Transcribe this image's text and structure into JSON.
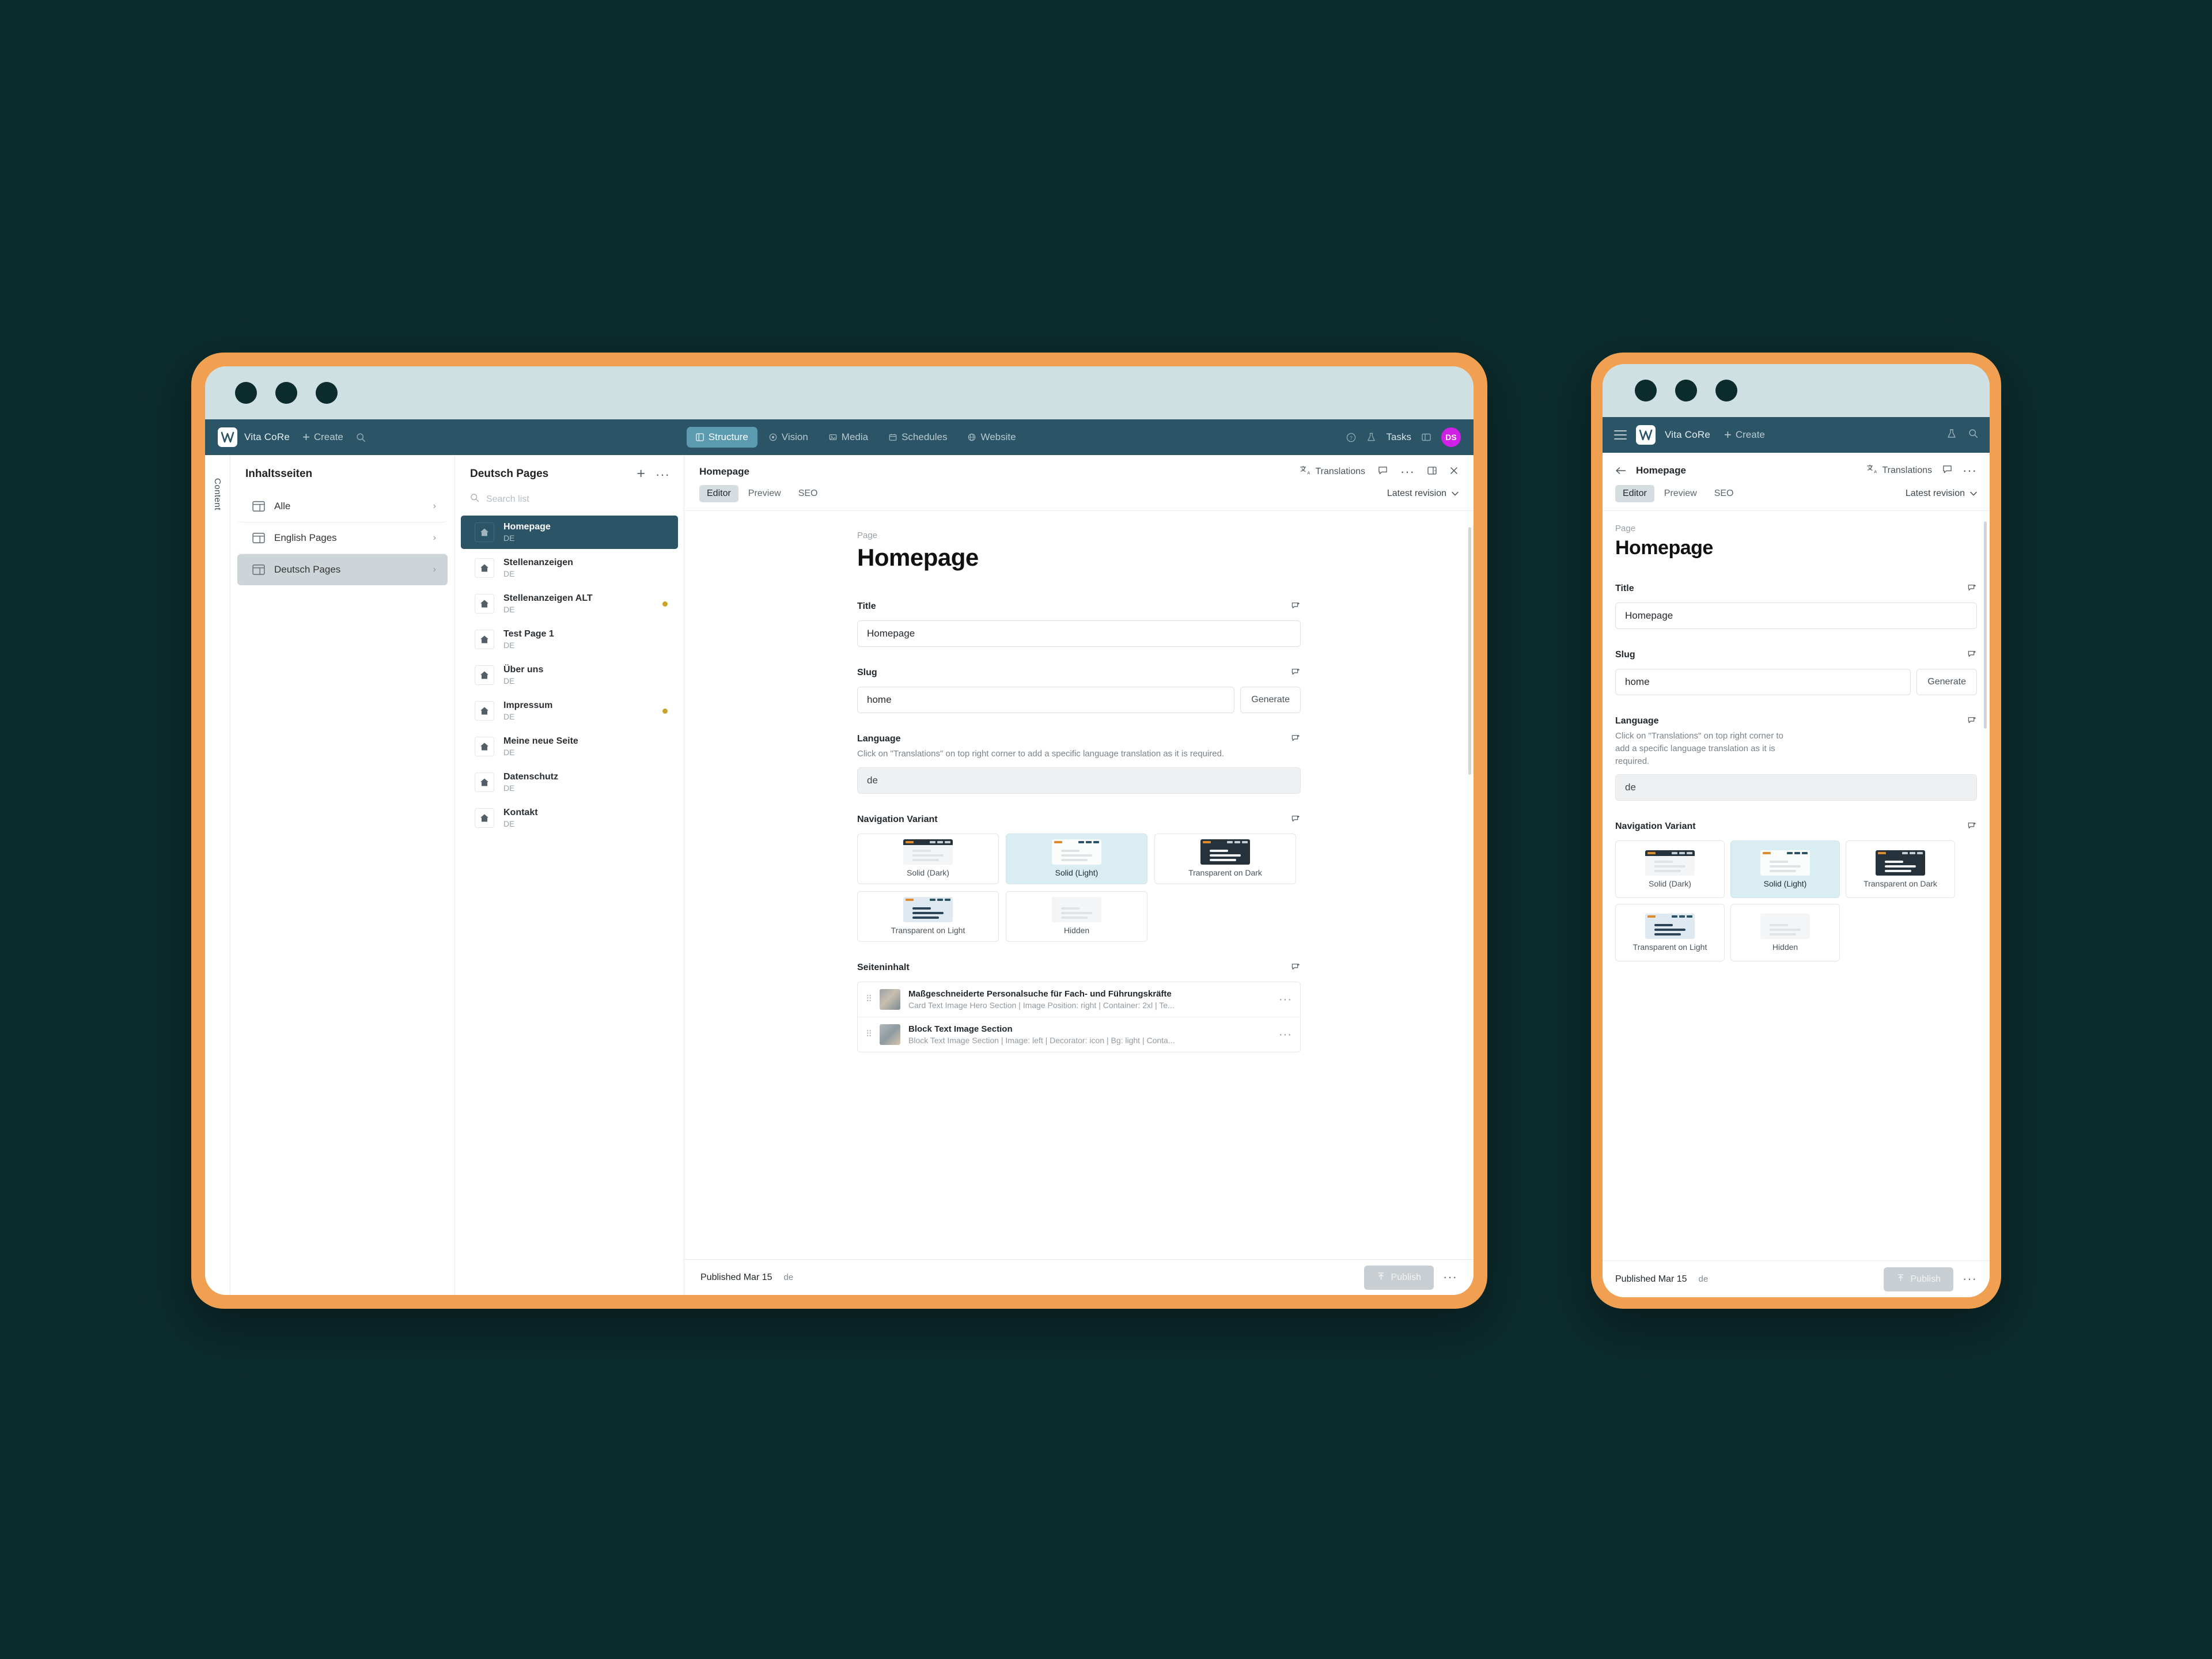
{
  "app": {
    "brand": "Vita CoRe",
    "create_label": "Create",
    "tasks_label": "Tasks",
    "avatar_initials": "DS",
    "nav_tabs": [
      {
        "label": "Structure",
        "icon": "structure-icon",
        "active": true
      },
      {
        "label": "Vision",
        "icon": "vision-icon",
        "active": false
      },
      {
        "label": "Media",
        "icon": "media-icon",
        "active": false
      },
      {
        "label": "Schedules",
        "icon": "calendar-icon",
        "active": false
      },
      {
        "label": "Website",
        "icon": "globe-icon",
        "active": false
      }
    ]
  },
  "rail": {
    "label": "Content"
  },
  "structure_panel": {
    "title": "Inhaltsseiten",
    "items": [
      {
        "label": "Alle",
        "selected": false
      },
      {
        "label": "English Pages",
        "selected": false
      },
      {
        "label": "Deutsch Pages",
        "selected": true
      }
    ]
  },
  "list_panel": {
    "title": "Deutsch Pages",
    "search_placeholder": "Search list",
    "pages": [
      {
        "name": "Homepage",
        "lang": "DE",
        "active": true,
        "dot": false
      },
      {
        "name": "Stellenanzeigen",
        "lang": "DE",
        "active": false,
        "dot": false
      },
      {
        "name": "Stellenanzeigen ALT",
        "lang": "DE",
        "active": false,
        "dot": true
      },
      {
        "name": "Test Page 1",
        "lang": "DE",
        "active": false,
        "dot": false
      },
      {
        "name": "Über uns",
        "lang": "DE",
        "active": false,
        "dot": false
      },
      {
        "name": "Impressum",
        "lang": "DE",
        "active": false,
        "dot": true
      },
      {
        "name": "Meine neue Seite",
        "lang": "DE",
        "active": false,
        "dot": false
      },
      {
        "name": "Datenschutz",
        "lang": "DE",
        "active": false,
        "dot": false
      },
      {
        "name": "Kontakt",
        "lang": "DE",
        "active": false,
        "dot": false
      }
    ]
  },
  "editor": {
    "header_title": "Homepage",
    "translations_label": "Translations",
    "tabs": [
      {
        "label": "Editor",
        "active": true
      },
      {
        "label": "Preview",
        "active": false
      },
      {
        "label": "SEO",
        "active": false
      }
    ],
    "revision_label": "Latest revision",
    "eyebrow": "Page",
    "doc_title": "Homepage",
    "fields": {
      "title": {
        "label": "Title",
        "value": "Homepage"
      },
      "slug": {
        "label": "Slug",
        "value": "home",
        "button": "Generate"
      },
      "language": {
        "label": "Language",
        "help": "Click on \"Translations\" on top right corner to add a specific language translation as it is required.",
        "help_mobile": "Click on \"Translations\" on top right corner to add a specific language translation as it is required.",
        "value": "de"
      },
      "navigation_variant": {
        "label": "Navigation Variant",
        "options": [
          {
            "label": "Solid (Dark)",
            "selected": false,
            "style": "solid-dark"
          },
          {
            "label": "Solid (Light)",
            "selected": true,
            "style": "solid-light"
          },
          {
            "label": "Transparent on Dark",
            "selected": false,
            "style": "transparent-dark"
          },
          {
            "label": "Transparent on Light",
            "selected": false,
            "style": "transparent-light"
          },
          {
            "label": "Hidden",
            "selected": false,
            "style": "hidden"
          }
        ]
      },
      "page_content": {
        "label": "Seiteninhalt",
        "rows": [
          {
            "title": "Maßgeschneiderte Personalsuche für Fach- und Führungskräfte",
            "subtitle": "Card Text Image Hero Section | Image Position: right | Container: 2xl | Te..."
          },
          {
            "title": "Block Text Image Section",
            "subtitle": "Block Text Image Section | Image: left | Decorator: icon | Bg: light | Conta..."
          }
        ]
      }
    },
    "footer": {
      "status": "Published Mar 15",
      "lang": "de",
      "publish_label": "Publish"
    }
  }
}
